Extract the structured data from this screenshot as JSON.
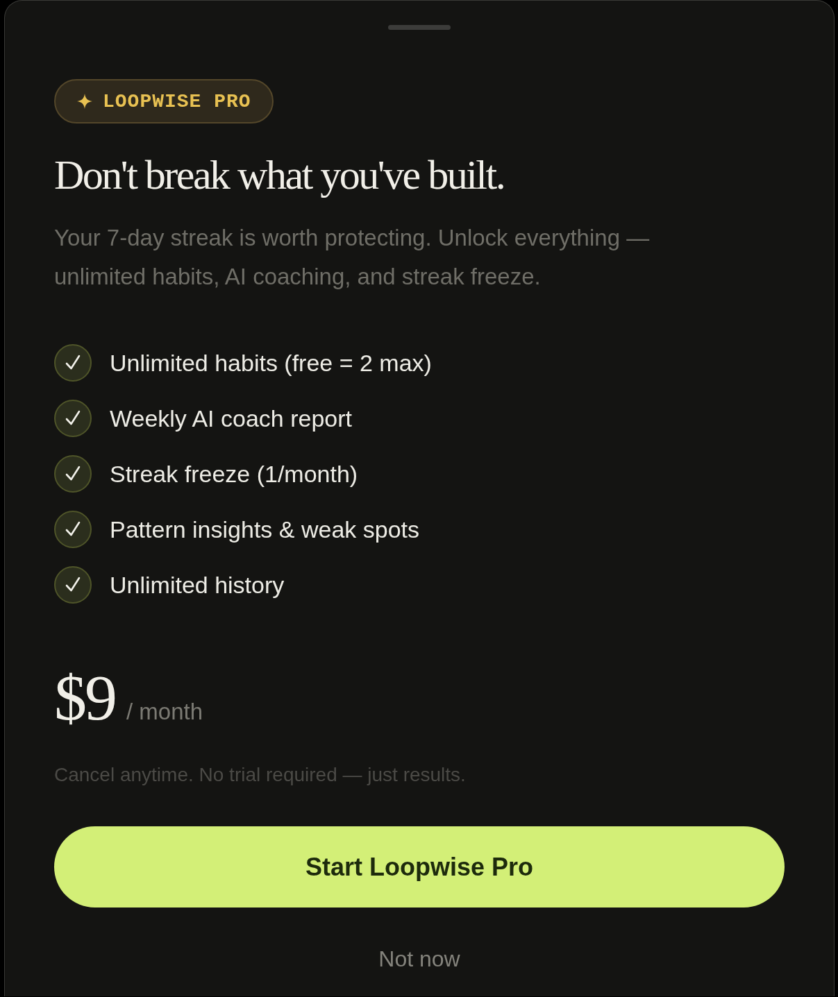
{
  "badge": {
    "label": "LOOPWISE PRO"
  },
  "title": "Don't break what you've built.",
  "subtitle": "Your 7-day streak is worth protecting. Unlock everything — unlimited habits, AI coaching, and streak freeze.",
  "features": [
    {
      "label": "Unlimited habits (free = 2 max)",
      "checked": true
    },
    {
      "label": "Weekly AI coach report",
      "checked": true
    },
    {
      "label": "Streak freeze (1/month)",
      "checked": true
    },
    {
      "label": "Pattern insights & weak spots",
      "checked": true
    },
    {
      "label": "Unlimited history",
      "checked": true
    }
  ],
  "price": {
    "amount": "$9",
    "period": "/ month"
  },
  "note": "Cancel anytime. No trial required — just results.",
  "primary_button": {
    "label": "Start Loopwise Pro"
  },
  "secondary_button": {
    "label": "Not now"
  }
}
